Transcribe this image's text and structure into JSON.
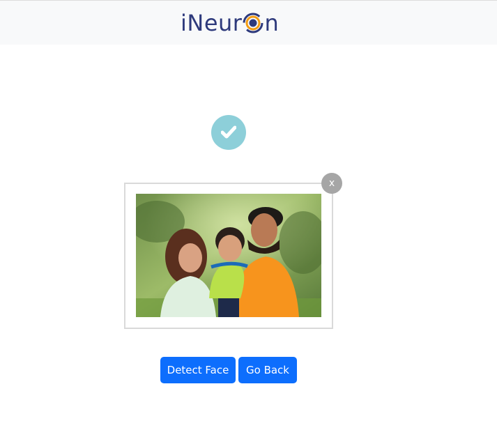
{
  "header": {
    "brand_prefix": "iNeur",
    "brand_suffix": "n",
    "brand_colors": {
      "text": "#2e3a7c",
      "ring_outer": "#f39c12",
      "ring_inner": "#2e3a7c"
    }
  },
  "status": {
    "icon": "check-icon",
    "color": "#8dcfd9"
  },
  "preview": {
    "remove_label": "x",
    "image_description_icon": "family-photo"
  },
  "actions": {
    "detect_label": "Detect Face",
    "back_label": "Go Back",
    "button_color": "#0d6efd"
  }
}
